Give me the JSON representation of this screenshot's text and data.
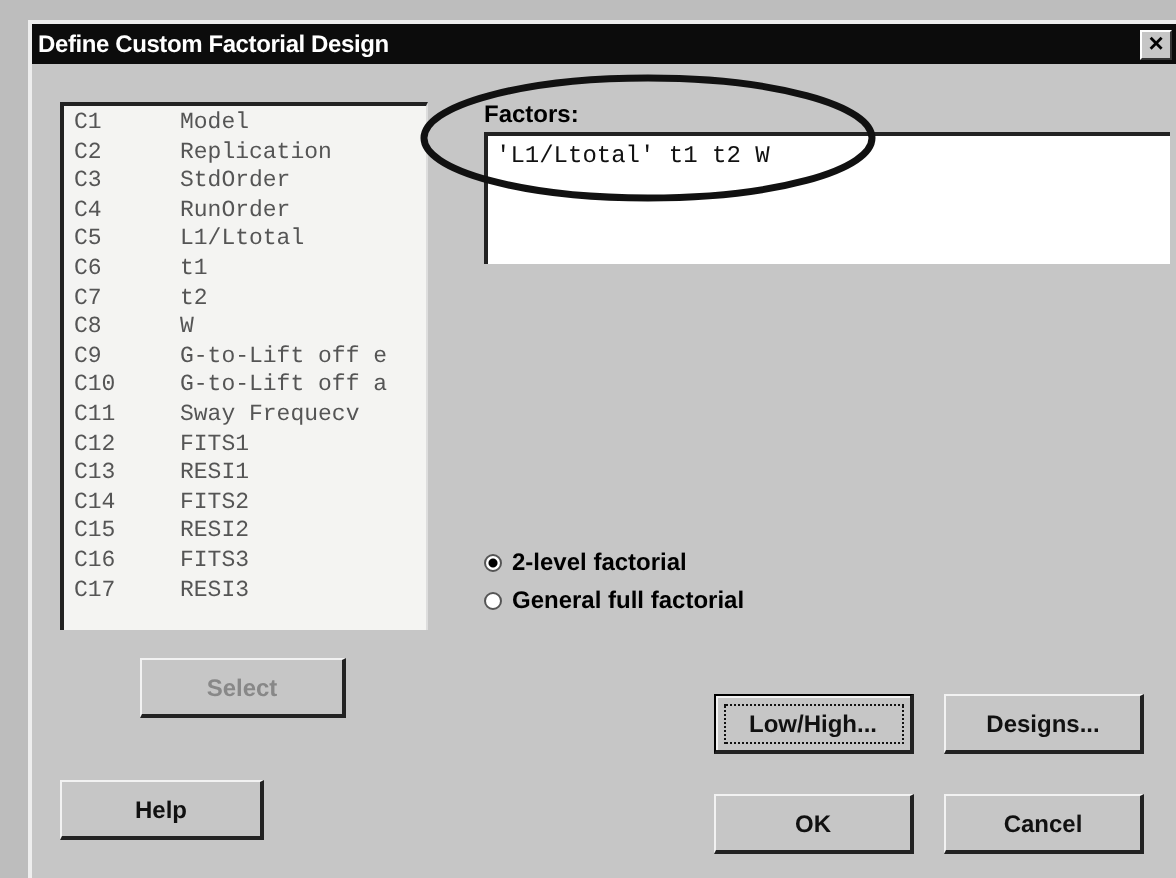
{
  "window": {
    "title": "Define Custom Factorial Design",
    "close": "×"
  },
  "columns": [
    {
      "id": "C1",
      "name": "Model"
    },
    {
      "id": "C2",
      "name": "Replication"
    },
    {
      "id": "C3",
      "name": "StdOrder"
    },
    {
      "id": "C4",
      "name": "RunOrder"
    },
    {
      "id": "C5",
      "name": "L1/Ltotal"
    },
    {
      "id": "C6",
      "name": "t1"
    },
    {
      "id": "C7",
      "name": "t2"
    },
    {
      "id": "C8",
      "name": "W"
    },
    {
      "id": "C9",
      "name": "G-to-Lift off e"
    },
    {
      "id": "C10",
      "name": "G-to-Lift off a"
    },
    {
      "id": "C11",
      "name": "Sway Frequecv"
    },
    {
      "id": "C12",
      "name": "FITS1"
    },
    {
      "id": "C13",
      "name": "RESI1"
    },
    {
      "id": "C14",
      "name": "FITS2"
    },
    {
      "id": "C15",
      "name": "RESI2"
    },
    {
      "id": "C16",
      "name": "FITS3"
    },
    {
      "id": "C17",
      "name": "RESI3"
    }
  ],
  "factors": {
    "label": "Factors:",
    "value": "'L1/Ltotal' t1 t2 W"
  },
  "design_type": [
    {
      "label": "2-level factorial",
      "selected": true
    },
    {
      "label": "General full factorial",
      "selected": false
    }
  ],
  "buttons": [
    {
      "kind": "select",
      "label": "Select",
      "disabled": true,
      "focused": false
    },
    {
      "kind": "lowhigh",
      "label": "Low/High...",
      "disabled": false,
      "focused": true
    },
    {
      "kind": "designs",
      "label": "Designs...",
      "disabled": false,
      "focused": false
    },
    {
      "kind": "help",
      "label": "Help",
      "disabled": false,
      "focused": false
    },
    {
      "kind": "ok",
      "label": "OK",
      "disabled": false,
      "focused": false
    },
    {
      "kind": "cancel",
      "label": "Cancel",
      "disabled": false,
      "focused": false
    }
  ]
}
